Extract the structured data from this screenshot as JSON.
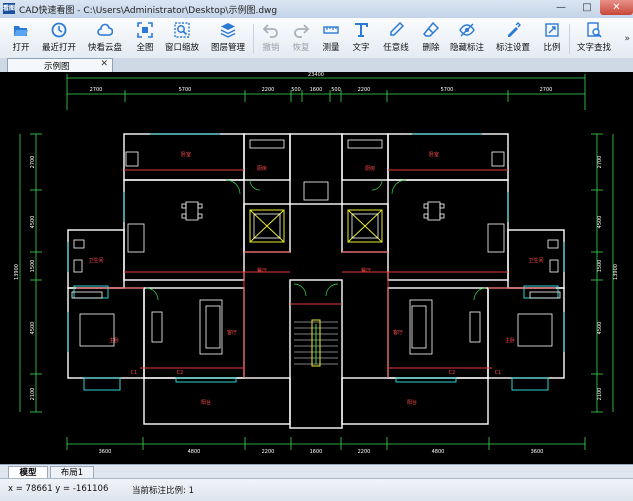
{
  "window": {
    "title": "CAD快速看图 - C:\\Users\\Administrator\\Desktop\\示例图.dwg",
    "logo": "看图",
    "min": "—",
    "max": "□",
    "close": "✕"
  },
  "toolbar": {
    "items": [
      {
        "label": "打开",
        "icon": "folder-open-icon"
      },
      {
        "label": "最近打开",
        "icon": "clock-icon"
      },
      {
        "label": "快看云盘",
        "icon": "cloud-icon"
      },
      {
        "label": "全图",
        "icon": "fit-view-icon"
      },
      {
        "label": "窗口缩放",
        "icon": "zoom-window-icon"
      },
      {
        "label": "图层管理",
        "icon": "layers-icon"
      },
      {
        "label": "撤销",
        "icon": "undo-icon",
        "disabled": true
      },
      {
        "label": "恢复",
        "icon": "redo-icon",
        "disabled": true
      },
      {
        "label": "测量",
        "icon": "ruler-icon"
      },
      {
        "label": "文字",
        "icon": "text-icon"
      },
      {
        "label": "任意线",
        "icon": "freeline-icon"
      },
      {
        "label": "删除",
        "icon": "eraser-icon"
      },
      {
        "label": "隐藏标注",
        "icon": "hide-annotation-icon"
      },
      {
        "label": "标注设置",
        "icon": "annotation-settings-icon"
      },
      {
        "label": "比例",
        "icon": "scale-icon"
      },
      {
        "label": "文字查找",
        "icon": "text-search-icon"
      }
    ],
    "more": "»"
  },
  "tabs": {
    "doc": "示例图",
    "close": "✕"
  },
  "drawing": {
    "total_dim": "23400",
    "top_dims": [
      "2700",
      "5700",
      "2200",
      "500",
      "1600",
      "500",
      "2200",
      "5700",
      "2700"
    ],
    "bottom_dims": [
      "3600",
      "4800",
      "2200",
      "1600",
      "2200",
      "4800",
      "3600"
    ],
    "left_dims": [
      "2700",
      "4500",
      "1500",
      "4500",
      "2100"
    ],
    "right_dims": [
      "2700",
      "4500",
      "1500",
      "4500",
      "2100"
    ],
    "overall_height": "13900",
    "room_labels": [
      "卧室",
      "厨房",
      "厨房",
      "卧室",
      "客厅",
      "餐厅",
      "餐厅",
      "客厅",
      "卫生间",
      "卫生间",
      "主卧",
      "主卧",
      "阳台",
      "阳台",
      "C1",
      "C2",
      "C1",
      "C2"
    ]
  },
  "sheets": {
    "model": "模型",
    "layout": "布局1"
  },
  "status": {
    "coords": "x = 78661  y = -161106",
    "scale": "当前标注比例: 1"
  }
}
